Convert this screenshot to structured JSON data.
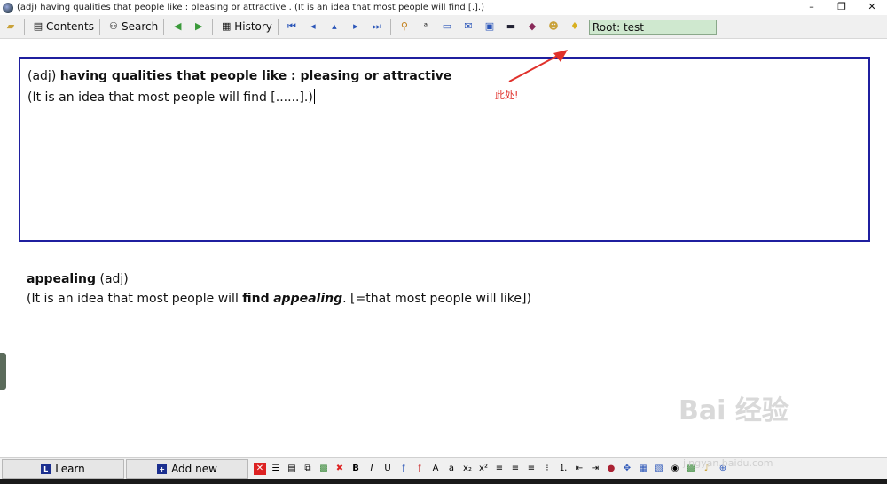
{
  "window": {
    "title": "(adj) having qualities that people like : pleasing or attractive . (It is an idea that most people will find [.].)",
    "controls": {
      "minimize": "–",
      "restore": "❐",
      "close": "✕"
    }
  },
  "toolbar": {
    "contents_label": "Contents",
    "search_label": "Search",
    "history_label": "History",
    "root_value": "Root: test"
  },
  "editor": {
    "prefix": "(adj) ",
    "definition": "having qualities that people like : pleasing or attractive",
    "example": "(It is an idea that most people will find [......].)"
  },
  "annotation": {
    "text": "此处!",
    "color": "#e0312b"
  },
  "entry": {
    "headword": "appealing",
    "pos": " (adj)",
    "ex_before": "(It is an idea that most people will ",
    "ex_bold": "find",
    "ex_space": " ",
    "ex_bold_italic": "appealing",
    "ex_after": ". [=that most people will like])"
  },
  "bottombar": {
    "learn_label": "Learn",
    "add_new_label": "Add new",
    "learn_icon": "L",
    "add_icon": "+"
  },
  "watermark": {
    "text": "Bai 经验",
    "url": "jingyan.baidu.com"
  },
  "colors": {
    "editor_border": "#1f1f9f",
    "root_bg": "#cfe8cf"
  }
}
